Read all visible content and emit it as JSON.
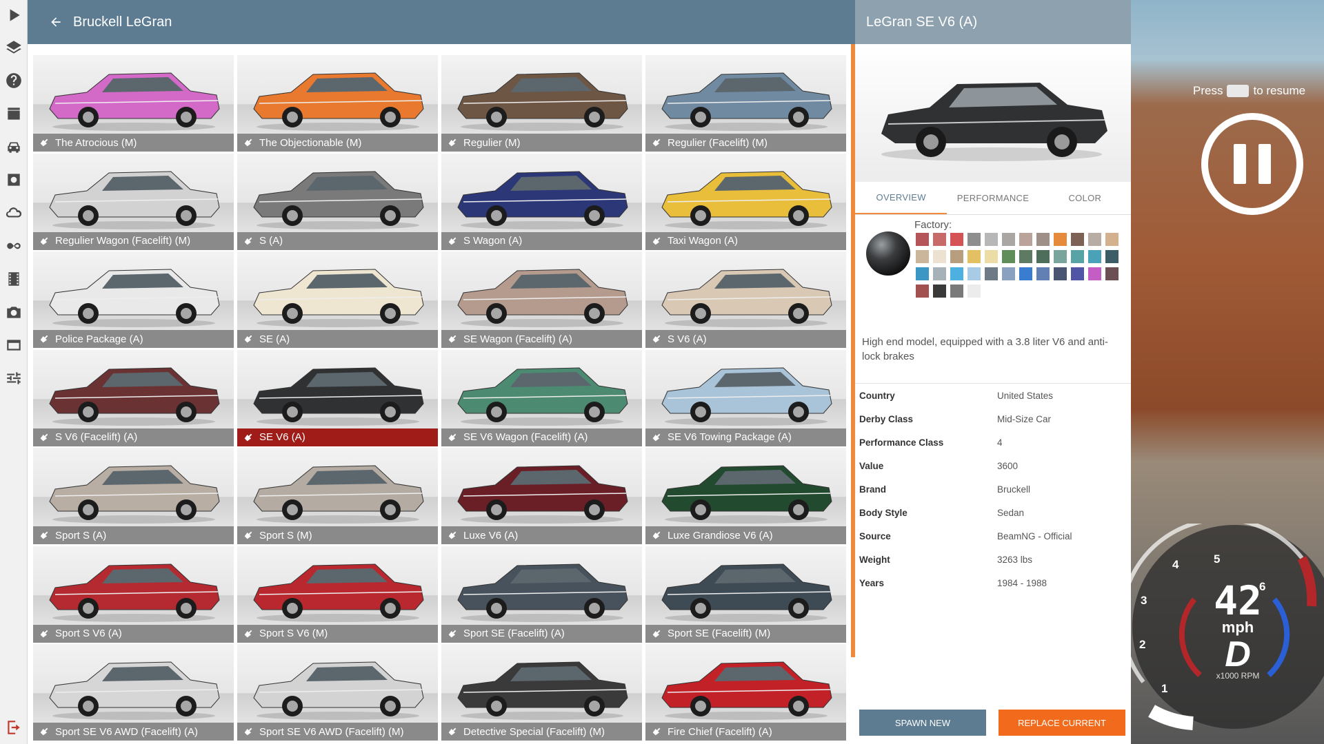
{
  "header": {
    "title": "Bruckell LeGran"
  },
  "toolbar": {
    "icons": [
      "play-icon",
      "layers-icon",
      "help-icon",
      "clapper-icon",
      "car-icon",
      "gear-icon",
      "cloud-icon",
      "infinity-icon",
      "film-icon",
      "camera-icon",
      "layout-icon",
      "sliders-icon",
      "exit-icon"
    ]
  },
  "vehicles": [
    {
      "label": "The Atrocious (M)",
      "color": "#d46ac8",
      "selected": false
    },
    {
      "label": "The Objectionable (M)",
      "color": "#e8792e",
      "selected": false
    },
    {
      "label": "Regulier (M)",
      "color": "#6e5645",
      "selected": false
    },
    {
      "label": "Regulier (Facelift) (M)",
      "color": "#6f8aa1",
      "selected": false
    },
    {
      "label": "Regulier Wagon (Facelift) (M)",
      "color": "#d2d2d2",
      "selected": false
    },
    {
      "label": "S (A)",
      "color": "#7a7a7a",
      "selected": false
    },
    {
      "label": "S Wagon (A)",
      "color": "#2c3778",
      "selected": false
    },
    {
      "label": "Taxi Wagon (A)",
      "color": "#e8be3a",
      "selected": false
    },
    {
      "label": "Police Package (A)",
      "color": "#e9e9e9",
      "selected": false
    },
    {
      "label": "SE (A)",
      "color": "#efe6d2",
      "selected": false
    },
    {
      "label": "SE Wagon (Facelift) (A)",
      "color": "#b59a8e",
      "selected": false
    },
    {
      "label": "S V6 (A)",
      "color": "#d8c8b4",
      "selected": false
    },
    {
      "label": "S V6 (Facelift) (A)",
      "color": "#6b3234",
      "selected": false
    },
    {
      "label": "SE V6 (A)",
      "color": "#2f3133",
      "selected": true
    },
    {
      "label": "SE V6 Wagon (Facelift) (A)",
      "color": "#4d8a72",
      "selected": false
    },
    {
      "label": "SE V6 Towing Package (A)",
      "color": "#a9c3d8",
      "selected": false
    },
    {
      "label": "Sport S (A)",
      "color": "#b8aea4",
      "selected": false
    },
    {
      "label": "Sport S (M)",
      "color": "#b4aba2",
      "selected": false
    },
    {
      "label": "Luxe V6 (A)",
      "color": "#6a1f26",
      "selected": false
    },
    {
      "label": "Luxe Grandiose V6 (A)",
      "color": "#224a2e",
      "selected": false
    },
    {
      "label": "Sport S V6 (A)",
      "color": "#b52a30",
      "selected": false
    },
    {
      "label": "Sport S V6 (M)",
      "color": "#b9282e",
      "selected": false
    },
    {
      "label": "Sport SE (Facelift) (A)",
      "color": "#47525c",
      "selected": false
    },
    {
      "label": "Sport SE (Facelift) (M)",
      "color": "#3e4a54",
      "selected": false
    },
    {
      "label": "Sport SE V6 AWD (Facelift) (A)",
      "color": "#d6d6d6",
      "selected": false
    },
    {
      "label": "Sport SE V6 AWD (Facelift) (M)",
      "color": "#d3d3d3",
      "selected": false
    },
    {
      "label": "Detective Special (Facelift) (M)",
      "color": "#3a3a3a",
      "selected": false
    },
    {
      "label": "Fire Chief (Facelift) (A)",
      "color": "#c22128",
      "selected": false
    }
  ],
  "details": {
    "title": "LeGran SE V6 (A)",
    "tabs": [
      {
        "label": "OVERVIEW",
        "active": true
      },
      {
        "label": "PERFORMANCE",
        "active": false
      },
      {
        "label": "COLOR",
        "active": false
      }
    ],
    "factory_label": "Factory:",
    "swatches": [
      "#b55559",
      "#c86a6a",
      "#d55355",
      "#8e8e8e",
      "#b7b7b7",
      "#aaa6a4",
      "#b9a39b",
      "#9e8f88",
      "#e68a3c",
      "#7d6154",
      "#b7ada5",
      "#d3b18f",
      "#cbb69c",
      "#ede1d1",
      "#b79e7e",
      "#e3c062",
      "#ecdca6",
      "#5f8e5a",
      "#5d7a62",
      "#4e6e5c",
      "#7aa59d",
      "#58a3a6",
      "#4aa2b8",
      "#3c5d66",
      "#3d97c4",
      "#a7b1b8",
      "#4cb0e0",
      "#a8cce6",
      "#6e7a86",
      "#8aa2c0",
      "#3a7cd0",
      "#6380b4",
      "#4a5574",
      "#5055a6",
      "#c45ec4",
      "#6b4f52",
      "#a35050",
      "#3a3a3a",
      "#7a7a7a",
      "#ececec"
    ],
    "description": "High end model, equipped with a 3.8 liter V6 and anti-lock brakes",
    "specs": [
      {
        "key": "Country",
        "value": "United States"
      },
      {
        "key": "Derby Class",
        "value": "Mid-Size Car"
      },
      {
        "key": "Performance Class",
        "value": "4"
      },
      {
        "key": "Value",
        "value": "3600"
      },
      {
        "key": "Brand",
        "value": "Bruckell"
      },
      {
        "key": "Body Style",
        "value": "Sedan"
      },
      {
        "key": "Source",
        "value": "BeamNG - Official"
      },
      {
        "key": "Weight",
        "value": "3263 lbs"
      },
      {
        "key": "Years",
        "value": "1984 - 1988"
      }
    ],
    "spawn_label": "SPAWN NEW",
    "replace_label": "REPLACE CURRENT"
  },
  "hud": {
    "resume_pre": "Press",
    "resume_post": "to resume",
    "speed": "42",
    "speed_unit": "mph",
    "gear": "D",
    "rpm_unit": "x1000 RPM",
    "gauge_numbers": [
      "1",
      "2",
      "3",
      "4",
      "5",
      "6"
    ]
  },
  "colors": {
    "header": "#5d7c92",
    "accent": "#f08a3a",
    "selected": "#a01c18",
    "replace": "#f26a1b"
  }
}
